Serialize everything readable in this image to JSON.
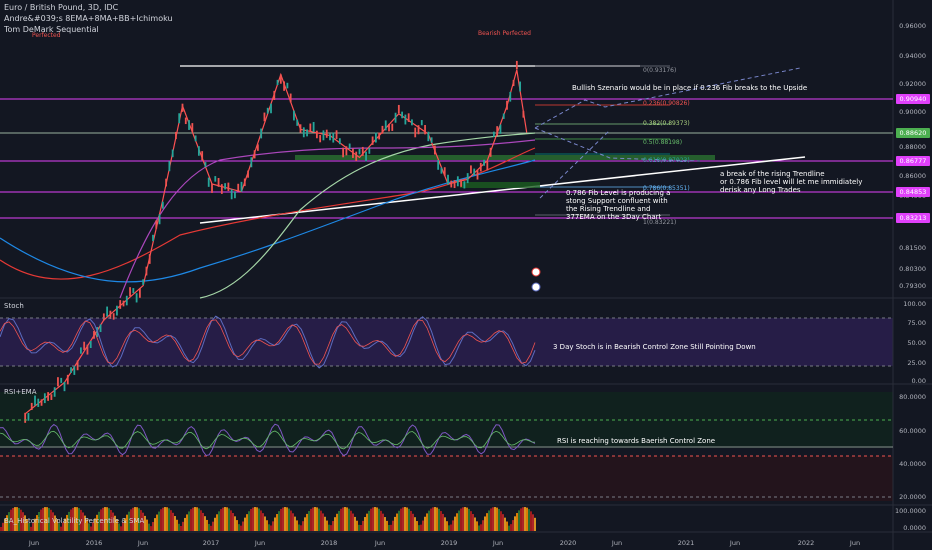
{
  "header": {
    "title": "Euro / British Pound, 3D, IDC",
    "study1": "Andre&#039;s 8EMA+8MA+BB+Ichimoku",
    "study2": "Tom DeMark Sequential"
  },
  "panels": {
    "stoch": "Stoch",
    "rsi": "RSI+EMA",
    "hv": "BA_Historical Volatility Percentile & SMA"
  },
  "marks": {
    "top1": "Perfected",
    "top2": "Bearish Perfected"
  },
  "annotations": {
    "bullish": "Bullish Szenario would be in place if 0.236 Fib breaks to the Upside",
    "trendline": "a break of the rising Trendline\nor 0.786 Fib level will let me immidiately\nderisk any Long Trades",
    "support": "0.786 Fib Level is producing a\nstong Support confluent with\nthe Rising Trendline and\n377EMA on the 3Day Chart",
    "stoch": "3 Day Stoch is in Bearish Control Zone Still Pointing Down",
    "rsi": "RSI is reaching towards Baerish Control Zone"
  },
  "fib_labels": [
    "0(0.93176)",
    "0.236(0.90826)",
    "0.382(0.89373)",
    "0.5(0.88198)",
    "0.618(0.87023)",
    "0.786(0.85351)",
    "1(0.83221)"
  ],
  "price_axis": [
    "0.96000",
    "0.94000",
    "0.92000",
    "0.90000",
    "0.88000",
    "0.86000",
    "0.84000",
    "0.81500",
    "0.80300",
    "0.79300"
  ],
  "price_tags": [
    {
      "label": "0.90940",
      "color": "#e040fb"
    },
    {
      "label": "0.88620",
      "color": "#4caf50"
    },
    {
      "label": "0.86777",
      "color": "#e040fb"
    },
    {
      "label": "0.84853",
      "color": "#e040fb"
    },
    {
      "label": "0.83213",
      "color": "#e040fb"
    }
  ],
  "stoch_axis": [
    "100.00",
    "75.00",
    "50.00",
    "25.00",
    "0.00"
  ],
  "rsi_axis": [
    "80.0000",
    "60.0000",
    "40.0000",
    "20.0000"
  ],
  "hv_axis": [
    "100.0000",
    "0.0000"
  ],
  "time_axis": [
    "Jun",
    "2016",
    "Jun",
    "2017",
    "Jun",
    "2018",
    "Jun",
    "2019",
    "Jun",
    "2020",
    "Jun",
    "2021",
    "Jun",
    "2022",
    "Jun"
  ],
  "chart_data": {
    "type": "line",
    "title": "Euro / British Pound, 3D, IDC",
    "series": [
      {
        "name": "Euro / British Pound",
        "x": [
          "2015-06",
          "2015-10",
          "2016-02",
          "2016-06",
          "2016-08",
          "2016-10",
          "2017-01",
          "2017-04",
          "2017-08",
          "2017-10",
          "2018-01",
          "2018-04",
          "2018-08",
          "2018-11",
          "2019-01",
          "2019-03",
          "2019-05",
          "2019-07",
          "2019-08",
          "2019-09"
        ],
        "values": [
          0.708,
          0.728,
          0.768,
          0.79,
          0.845,
          0.905,
          0.855,
          0.85,
          0.925,
          0.89,
          0.886,
          0.872,
          0.9,
          0.887,
          0.855,
          0.858,
          0.87,
          0.905,
          0.928,
          0.888
        ]
      }
    ],
    "fib_levels": [
      0.93176,
      0.90826,
      0.89373,
      0.88198,
      0.87023,
      0.85351,
      0.83221
    ],
    "horizontal_levels": [
      0.9094,
      0.8862,
      0.86777,
      0.84853,
      0.83213
    ],
    "stoch_zones": [
      80,
      20
    ],
    "rsi_zones": [
      70,
      50,
      30
    ]
  }
}
